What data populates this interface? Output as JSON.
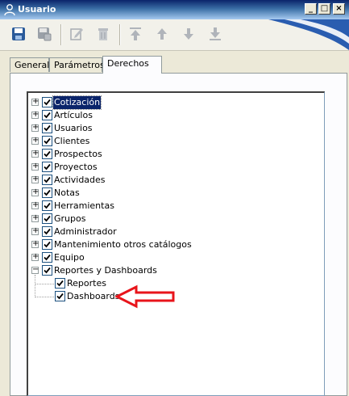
{
  "window": {
    "title": "Usuario"
  },
  "toolbar": {
    "buttons": [
      "save-icon",
      "save-close-icon",
      "edit-icon",
      "delete-icon",
      "move-first-icon",
      "move-up-icon",
      "move-down-icon",
      "move-last-icon"
    ]
  },
  "tabs": [
    {
      "label": "General",
      "active": false
    },
    {
      "label": "Parámetros",
      "active": false
    },
    {
      "label": "Derechos",
      "active": true
    }
  ],
  "tree": {
    "items": [
      {
        "label": "Cotización",
        "expander": "+",
        "checked": true,
        "selected": true
      },
      {
        "label": "Artículos",
        "expander": "+",
        "checked": true
      },
      {
        "label": "Usuarios",
        "expander": "+",
        "checked": true
      },
      {
        "label": "Clientes",
        "expander": "+",
        "checked": true
      },
      {
        "label": "Prospectos",
        "expander": "+",
        "checked": true
      },
      {
        "label": "Proyectos",
        "expander": "+",
        "checked": true
      },
      {
        "label": "Actividades",
        "expander": "+",
        "checked": true
      },
      {
        "label": "Notas",
        "expander": "+",
        "checked": true
      },
      {
        "label": "Herramientas",
        "expander": "+",
        "checked": true
      },
      {
        "label": "Grupos",
        "expander": "+",
        "checked": true
      },
      {
        "label": "Administrador",
        "expander": "+",
        "checked": true
      },
      {
        "label": "Mantenimiento otros catálogos",
        "expander": "+",
        "checked": true
      },
      {
        "label": "Equipo",
        "expander": "+",
        "checked": true
      },
      {
        "label": "Reportes y Dashboards",
        "expander": "−",
        "checked": true,
        "children": [
          {
            "label": "Reportes",
            "checked": true
          },
          {
            "label": "Dashboards",
            "checked": true
          }
        ]
      }
    ]
  },
  "colors": {
    "annotation_arrow": "#e8141b",
    "selection": "#0a246a"
  }
}
